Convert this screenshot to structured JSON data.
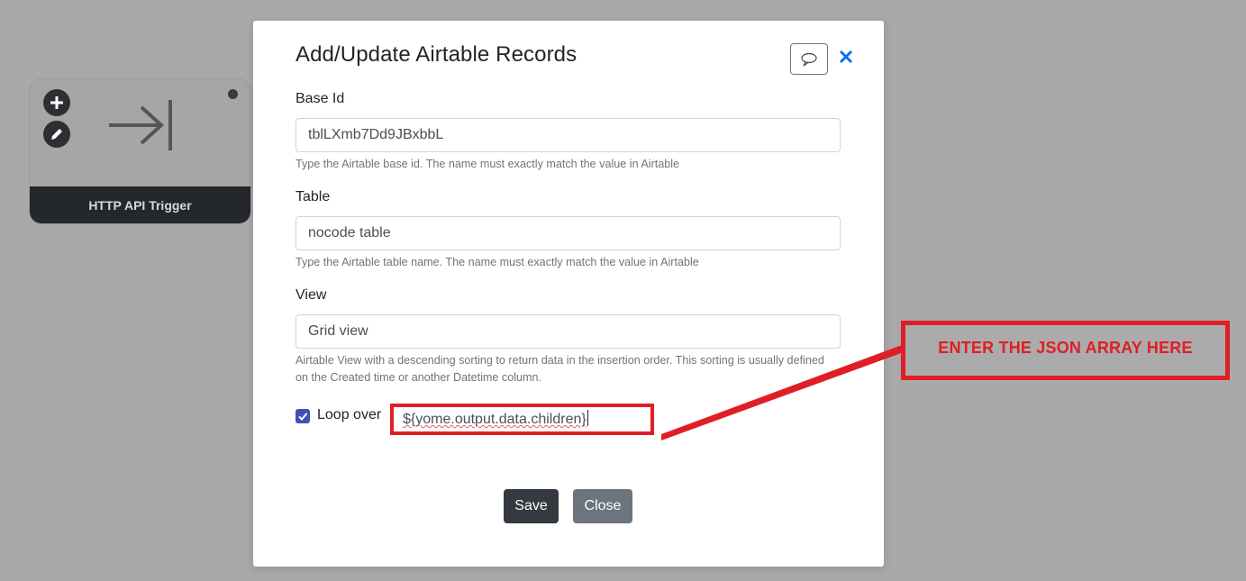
{
  "node": {
    "footer_label": "HTTP API Trigger",
    "icons": [
      "plus-icon",
      "pencil-icon",
      "arrow-to-bar-icon",
      "status-dot-icon"
    ]
  },
  "modal": {
    "title": "Add/Update Airtable Records",
    "fields": [
      {
        "label": "Base Id",
        "value": "tblLXmb7Dd9JBxbbL",
        "help": "Type the Airtable base id. The name must exactly match the value in Airtable"
      },
      {
        "label": "Table",
        "value": "nocode table",
        "help": "Type the Airtable table name. The name must exactly match the value in Airtable"
      },
      {
        "label": "View",
        "value": "Grid view",
        "help": "Airtable View with a descending sorting to return data in the insertion order. This sorting is usually defined on the Created time or another Datetime column."
      }
    ],
    "loop": {
      "label": "Loop over",
      "checked": true,
      "value": "${yome.output.data.children}"
    },
    "buttons": {
      "save": "Save",
      "close": "Close"
    }
  },
  "annotation": {
    "text": "ENTER THE JSON ARRAY HERE",
    "color": "#e01e26"
  }
}
